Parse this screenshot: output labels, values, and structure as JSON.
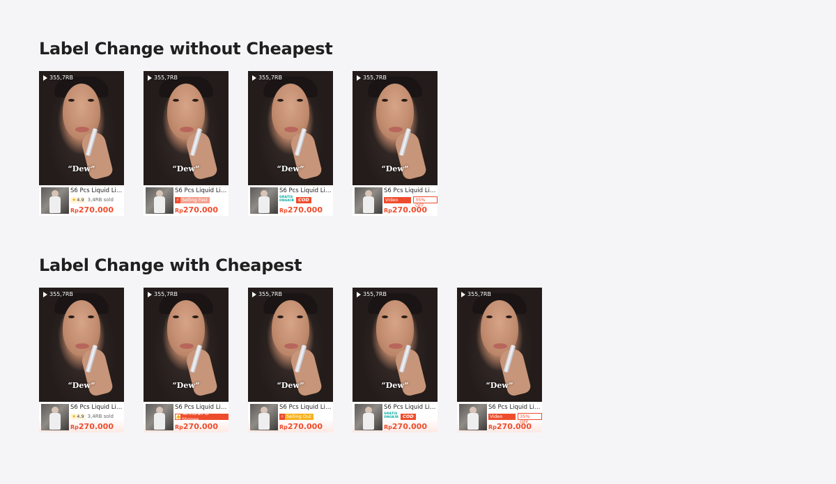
{
  "sections": [
    {
      "title": "Label Change without Cheapest",
      "cards": [
        {
          "views": "355,7RB",
          "caption": "“Dew”",
          "name": "S6 Pcs Liquid Lip...",
          "label_type": "rating",
          "rating": "4.9",
          "sold": "3,4RB sold",
          "currency": "Rp",
          "price": "270.000"
        },
        {
          "views": "355,7RB",
          "caption": "“Dew”",
          "name": "S6 Pcs Liquid Lip...",
          "label_type": "selling",
          "badge": "Selling Fast",
          "badge_color": "#f3a08f",
          "currency": "Rp",
          "price": "270.000"
        },
        {
          "views": "355,7RB",
          "caption": "“Dew”",
          "name": "S6 Pcs Liquid Lip...",
          "label_type": "gratis",
          "gratis_1": "GRATIS",
          "gratis_2": "ONGKIR",
          "cod": "COD",
          "currency": "Rp",
          "price": "270.000"
        },
        {
          "views": "355,7RB",
          "caption": "“Dew”",
          "name": "S6 Pcs Liquid Lip...",
          "label_type": "video",
          "badge": "Video Only",
          "off": "35% OFF",
          "currency": "Rp",
          "price": "270.000"
        }
      ]
    },
    {
      "title": "Label Change with Cheapest",
      "cards": [
        {
          "views": "355,7RB",
          "caption": "“Dew”",
          "name": "S6 Pcs Liquid Lip...",
          "label_type": "rating",
          "rating": "4.9",
          "sold": "3,4RB sold",
          "currency": "Rp",
          "price": "270.000"
        },
        {
          "views": "355,7RB",
          "caption": "“Dew”",
          "name": "S6 Pcs Liquid Lip...",
          "label_type": "murah",
          "badge": "Termurah di Shopee",
          "currency": "Rp",
          "price": "270.000"
        },
        {
          "views": "355,7RB",
          "caption": "“Dew”",
          "name": "S6 Pcs Liquid Lip...",
          "label_type": "selling",
          "badge": "Selling Out",
          "badge_color": "#f7b21c",
          "currency": "Rp",
          "price": "270.000"
        },
        {
          "views": "355,7RB",
          "caption": "“Dew”",
          "name": "S6 Pcs Liquid Lip...",
          "label_type": "gratis",
          "gratis_1": "GRATIS",
          "gratis_2": "ONGKIR",
          "cod": "COD",
          "currency": "Rp",
          "price": "270.000"
        },
        {
          "views": "355,7RB",
          "caption": "“Dew”",
          "name": "S6 Pcs Liquid Lip...",
          "label_type": "video",
          "badge": "Video Only",
          "off": "35% OFF",
          "currency": "Rp",
          "price": "270.000"
        }
      ]
    }
  ],
  "colors": {
    "accent": "#ee4d2d",
    "gratis": "#00a79d",
    "star": "#f5b400",
    "background": "#f5f5f7"
  },
  "icons": [
    "play-icon",
    "star-icon",
    "bolt-icon",
    "thumbs-up-icon"
  ]
}
